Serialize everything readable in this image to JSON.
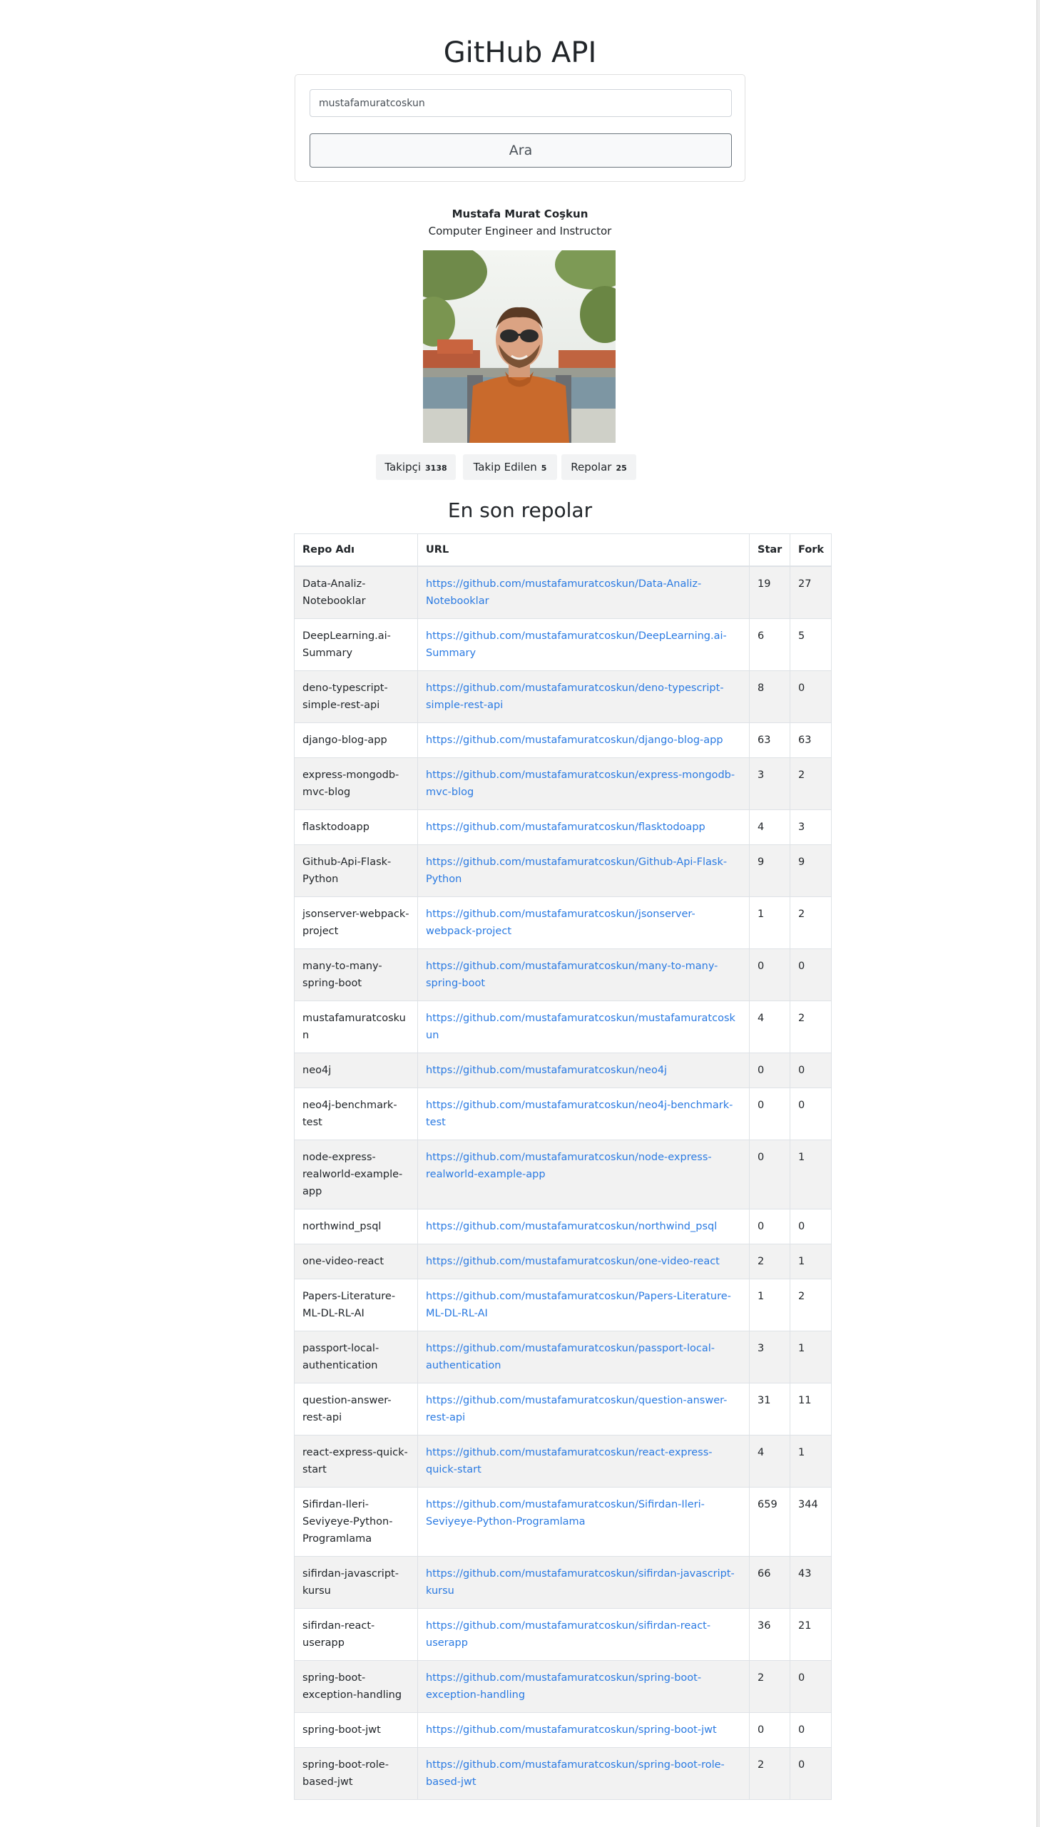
{
  "header": {
    "title": "GitHub API"
  },
  "search": {
    "value": "mustafamuratcoskun",
    "button_label": "Ara"
  },
  "profile": {
    "name": "Mustafa Murat Coşkun",
    "bio": "Computer Engineer and Instructor",
    "stats": {
      "followers_label": "Takipçi",
      "followers": "3138",
      "following_label": "Takip Edilen",
      "following": "5",
      "repos_label": "Repolar",
      "repos": "25"
    }
  },
  "repos_section": {
    "title": "En son repolar",
    "columns": {
      "name": "Repo Adı",
      "url": "URL",
      "star": "Star",
      "fork": "Fork"
    },
    "rows": [
      {
        "name": "Data-Analiz-Notebooklar",
        "url": "https://github.com/mustafamuratcoskun/Data-Analiz-Notebooklar",
        "star": "19",
        "fork": "27"
      },
      {
        "name": "DeepLearning.ai-Summary",
        "url": "https://github.com/mustafamuratcoskun/DeepLearning.ai-Summary",
        "star": "6",
        "fork": "5"
      },
      {
        "name": "deno-typescript-simple-rest-api",
        "url": "https://github.com/mustafamuratcoskun/deno-typescript-simple-rest-api",
        "star": "8",
        "fork": "0"
      },
      {
        "name": "django-blog-app",
        "url": "https://github.com/mustafamuratcoskun/django-blog-app",
        "star": "63",
        "fork": "63"
      },
      {
        "name": "express-mongodb-mvc-blog",
        "url": "https://github.com/mustafamuratcoskun/express-mongodb-mvc-blog",
        "star": "3",
        "fork": "2"
      },
      {
        "name": "flasktodoapp",
        "url": "https://github.com/mustafamuratcoskun/flasktodoapp",
        "star": "4",
        "fork": "3"
      },
      {
        "name": "Github-Api-Flask-Python",
        "url": "https://github.com/mustafamuratcoskun/Github-Api-Flask-Python",
        "star": "9",
        "fork": "9"
      },
      {
        "name": "jsonserver-webpack-project",
        "url": "https://github.com/mustafamuratcoskun/jsonserver-webpack-project",
        "star": "1",
        "fork": "2"
      },
      {
        "name": "many-to-many-spring-boot",
        "url": "https://github.com/mustafamuratcoskun/many-to-many-spring-boot",
        "star": "0",
        "fork": "0"
      },
      {
        "name": "mustafamuratcoskun",
        "url": "https://github.com/mustafamuratcoskun/mustafamuratcoskun",
        "star": "4",
        "fork": "2"
      },
      {
        "name": "neo4j",
        "url": "https://github.com/mustafamuratcoskun/neo4j",
        "star": "0",
        "fork": "0"
      },
      {
        "name": "neo4j-benchmark-test",
        "url": "https://github.com/mustafamuratcoskun/neo4j-benchmark-test",
        "star": "0",
        "fork": "0"
      },
      {
        "name": "node-express-realworld-example-app",
        "url": "https://github.com/mustafamuratcoskun/node-express-realworld-example-app",
        "star": "0",
        "fork": "1"
      },
      {
        "name": "northwind_psql",
        "url": "https://github.com/mustafamuratcoskun/northwind_psql",
        "star": "0",
        "fork": "0"
      },
      {
        "name": "one-video-react",
        "url": "https://github.com/mustafamuratcoskun/one-video-react",
        "star": "2",
        "fork": "1"
      },
      {
        "name": "Papers-Literature-ML-DL-RL-AI",
        "url": "https://github.com/mustafamuratcoskun/Papers-Literature-ML-DL-RL-AI",
        "star": "1",
        "fork": "2"
      },
      {
        "name": "passport-local-authentication",
        "url": "https://github.com/mustafamuratcoskun/passport-local-authentication",
        "star": "3",
        "fork": "1"
      },
      {
        "name": "question-answer-rest-api",
        "url": "https://github.com/mustafamuratcoskun/question-answer-rest-api",
        "star": "31",
        "fork": "11"
      },
      {
        "name": "react-express-quick-start",
        "url": "https://github.com/mustafamuratcoskun/react-express-quick-start",
        "star": "4",
        "fork": "1"
      },
      {
        "name": "Sifirdan-Ileri-Seviyeye-Python-Programlama",
        "url": "https://github.com/mustafamuratcoskun/Sifirdan-Ileri-Seviyeye-Python-Programlama",
        "star": "659",
        "fork": "344"
      },
      {
        "name": "sifirdan-javascript-kursu",
        "url": "https://github.com/mustafamuratcoskun/sifirdan-javascript-kursu",
        "star": "66",
        "fork": "43"
      },
      {
        "name": "sifirdan-react-userapp",
        "url": "https://github.com/mustafamuratcoskun/sifirdan-react-userapp",
        "star": "36",
        "fork": "21"
      },
      {
        "name": "spring-boot-exception-handling",
        "url": "https://github.com/mustafamuratcoskun/spring-boot-exception-handling",
        "star": "2",
        "fork": "0"
      },
      {
        "name": "spring-boot-jwt",
        "url": "https://github.com/mustafamuratcoskun/spring-boot-jwt",
        "star": "0",
        "fork": "0"
      },
      {
        "name": "spring-boot-role-based-jwt",
        "url": "https://github.com/mustafamuratcoskun/spring-boot-role-based-jwt",
        "star": "2",
        "fork": "0"
      }
    ]
  }
}
